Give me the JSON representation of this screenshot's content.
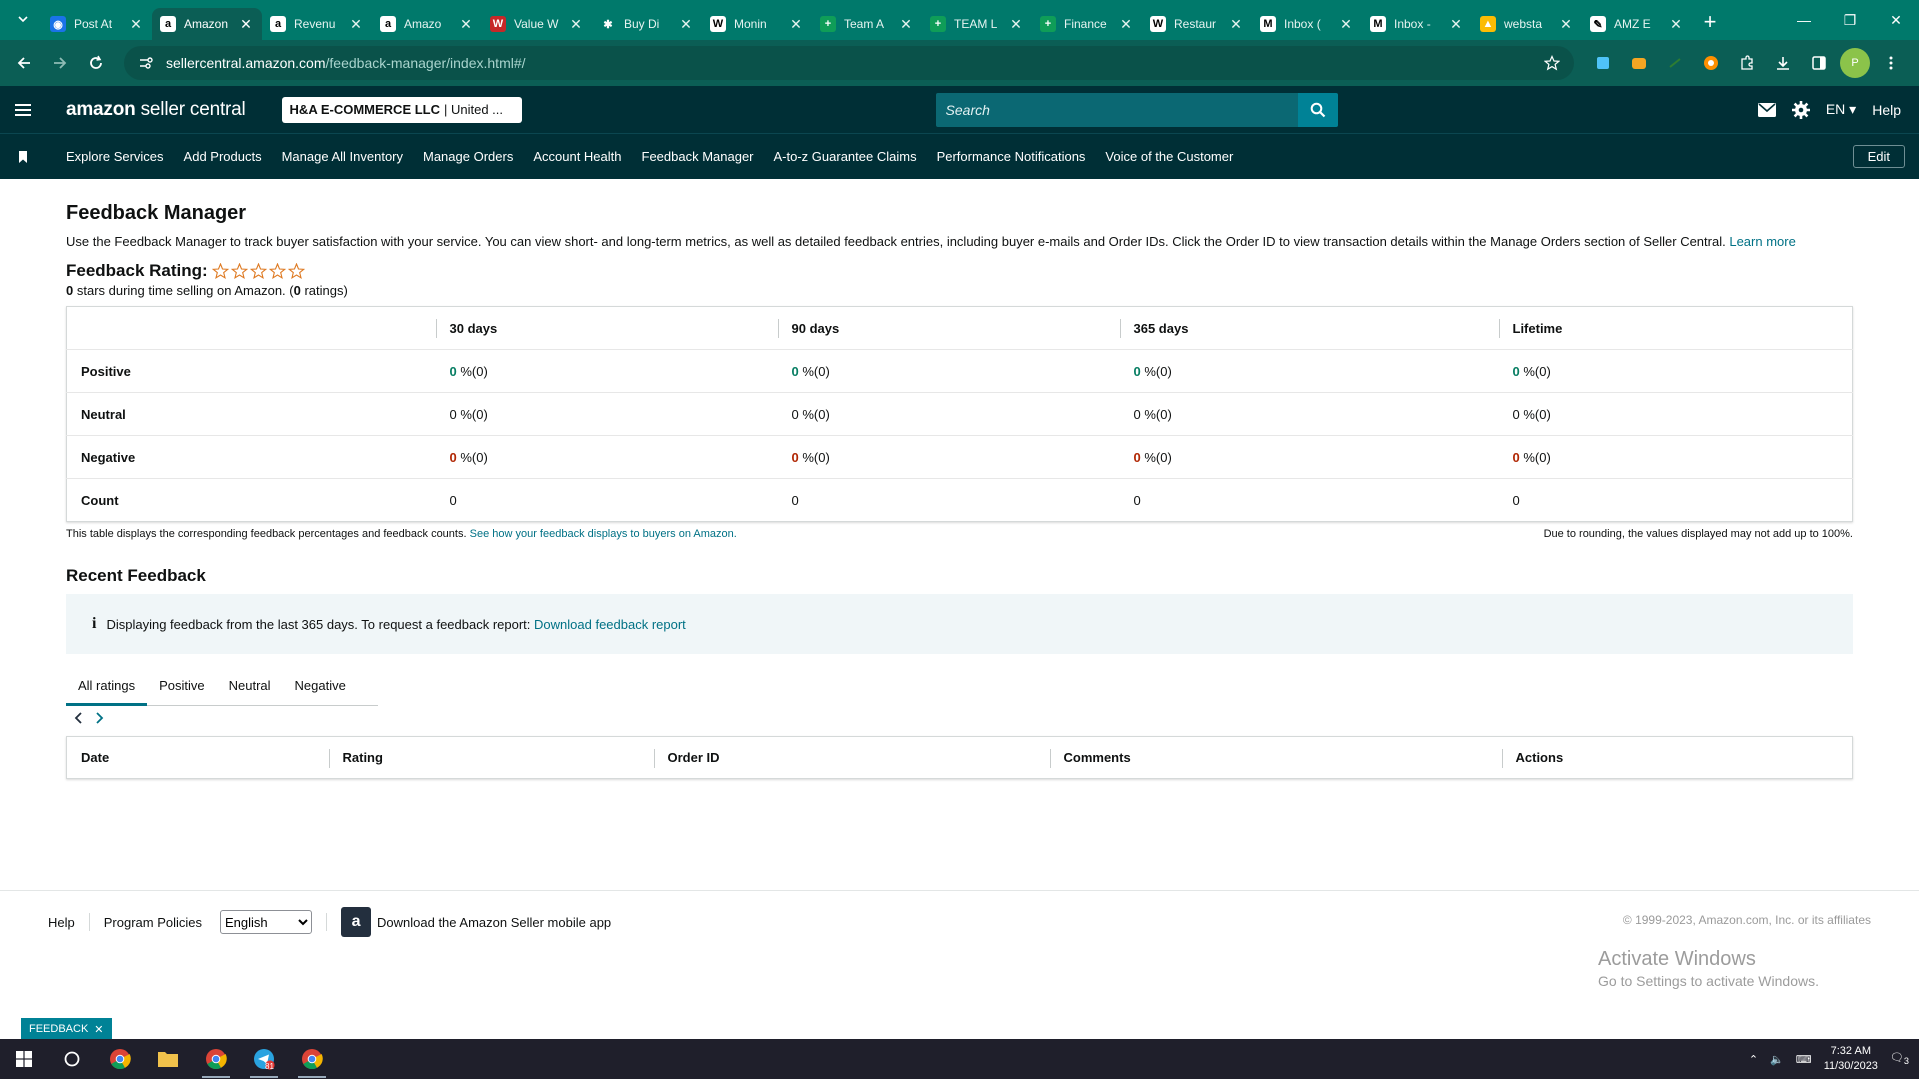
{
  "browser": {
    "tabs": [
      {
        "title": "Post At",
        "fav_color": "#1a73e8",
        "fav_char": "◉",
        "active": false
      },
      {
        "title": "Amazon",
        "fav_color": "#ffffff",
        "fav_char": "a",
        "active": true
      },
      {
        "title": "Revenu",
        "fav_color": "#ffffff",
        "fav_char": "a",
        "active": false
      },
      {
        "title": "Amazo",
        "fav_color": "#ffffff",
        "fav_char": "a",
        "active": false
      },
      {
        "title": "Value W",
        "fav_color": "#c62828",
        "fav_char": "W",
        "active": false
      },
      {
        "title": "Buy Di",
        "fav_color": "#00796b",
        "fav_char": "✱",
        "active": false
      },
      {
        "title": "Monin",
        "fav_color": "#ffffff",
        "fav_char": "W",
        "active": false
      },
      {
        "title": "Team A",
        "fav_color": "#0f9d58",
        "fav_char": "+",
        "active": false
      },
      {
        "title": "TEAM L",
        "fav_color": "#0f9d58",
        "fav_char": "+",
        "active": false
      },
      {
        "title": "Finance",
        "fav_color": "#0f9d58",
        "fav_char": "+",
        "active": false
      },
      {
        "title": "Restaur",
        "fav_color": "#ffffff",
        "fav_char": "W",
        "active": false
      },
      {
        "title": "Inbox (",
        "fav_color": "#ffffff",
        "fav_char": "M",
        "active": false
      },
      {
        "title": "Inbox -",
        "fav_color": "#ffffff",
        "fav_char": "M",
        "active": false
      },
      {
        "title": "websta",
        "fav_color": "#fbbc04",
        "fav_char": "▲",
        "active": false
      },
      {
        "title": "AMZ E",
        "fav_color": "#ffffff",
        "fav_char": "✎",
        "active": false
      }
    ],
    "url_host": "sellercentral.amazon.com",
    "url_path": "/feedback-manager/index.html#/",
    "profile_initial": "P"
  },
  "header": {
    "logo_brand": "amazon",
    "logo_rest": " seller central",
    "account_name": "H&A E-COMMERCE LLC",
    "account_region": "| United ...",
    "search_placeholder": "Search",
    "language": "EN",
    "help": "Help"
  },
  "nav": {
    "items": [
      "Explore Services",
      "Add Products",
      "Manage All Inventory",
      "Manage Orders",
      "Account Health",
      "Feedback Manager",
      "A-to-z Guarantee Claims",
      "Performance Notifications",
      "Voice of the Customer"
    ],
    "edit_label": "Edit"
  },
  "page": {
    "title": "Feedback Manager",
    "description": "Use the Feedback Manager to track buyer satisfaction with your service. You can view short- and long-term metrics, as well as detailed feedback entries, including buyer e-mails and Order IDs. Click the Order ID to view transaction details within the Manage Orders section of Seller Central.",
    "learn_more": "Learn more",
    "rating_label": "Feedback Rating:",
    "stars_value": "0",
    "stars_text": " stars during time selling on Amazon. (",
    "ratings_count": "0",
    "ratings_text": " ratings)"
  },
  "feedback_table": {
    "columns": [
      "30 days",
      "90 days",
      "365 days",
      "Lifetime"
    ],
    "rows": [
      {
        "label": "Positive",
        "kind": "g",
        "cells": [
          [
            "0",
            " %(0)"
          ],
          [
            "0",
            " %(0)"
          ],
          [
            "0",
            " %(0)"
          ],
          [
            "0",
            " %(0)"
          ]
        ]
      },
      {
        "label": "Neutral",
        "kind": "n",
        "cells": [
          [
            "0",
            " %(0)"
          ],
          [
            "0",
            " %(0)"
          ],
          [
            "0",
            " %(0)"
          ],
          [
            "0",
            " %(0)"
          ]
        ]
      },
      {
        "label": "Negative",
        "kind": "r",
        "cells": [
          [
            "0",
            " %(0)"
          ],
          [
            "0",
            " %(0)"
          ],
          [
            "0",
            " %(0)"
          ],
          [
            "0",
            " %(0)"
          ]
        ]
      },
      {
        "label": "Count",
        "kind": "n",
        "cells": [
          [
            "0",
            ""
          ],
          [
            "0",
            ""
          ],
          [
            "0",
            ""
          ],
          [
            "0",
            ""
          ]
        ]
      }
    ],
    "note_left": "This table displays the corresponding feedback percentages and feedback counts.",
    "note_link": "See how your feedback displays to buyers on Amazon.",
    "note_right": "Due to rounding, the values displayed may not add up to 100%."
  },
  "recent": {
    "title": "Recent Feedback",
    "info_text": "Displaying feedback from the last 365 days. To request a feedback report:",
    "info_link": "Download feedback report",
    "tabs": [
      "All ratings",
      "Positive",
      "Neutral",
      "Negative"
    ],
    "columns": [
      "Date",
      "Rating",
      "Order ID",
      "Comments",
      "Actions"
    ]
  },
  "footer": {
    "help": "Help",
    "policies": "Program Policies",
    "language": "English",
    "app_text": "Download the Amazon Seller mobile app",
    "copyright": "© 1999-2023, Amazon.com, Inc. or its affiliates"
  },
  "watermark": {
    "line1": "Activate Windows",
    "line2": "Go to Settings to activate Windows."
  },
  "feedback_button": "FEEDBACK",
  "taskbar": {
    "time": "7:32 AM",
    "date": "11/30/2023",
    "notifications": "3",
    "badge_count": "81"
  }
}
